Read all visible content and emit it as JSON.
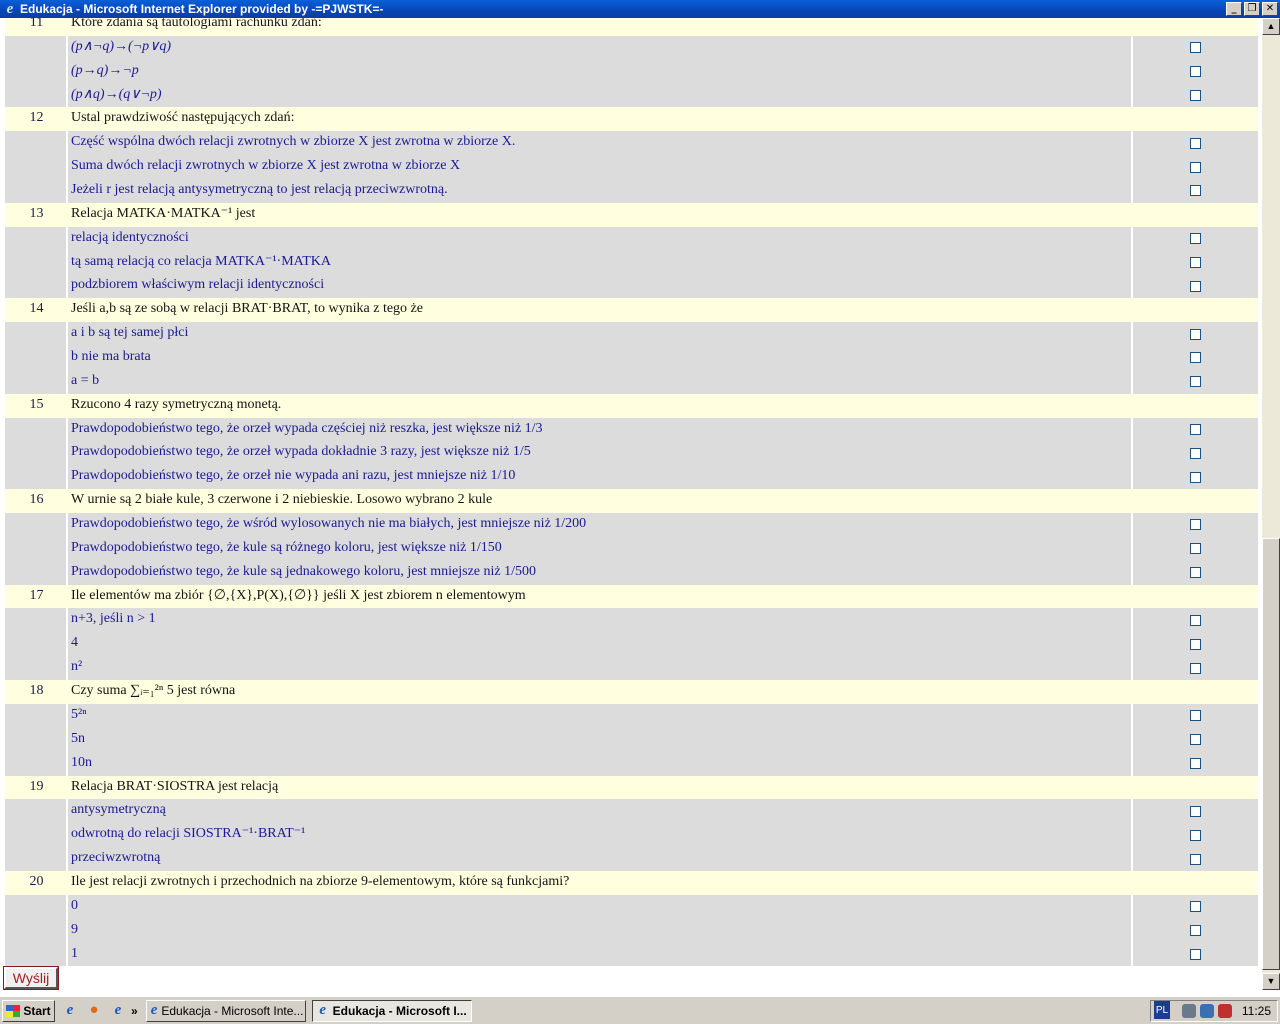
{
  "window": {
    "title": "Edukacja - Microsoft Internet Explorer provided by -=PJWSTK=-",
    "icon": "ie-icon",
    "buttons": [
      "_",
      "❐",
      "✕"
    ]
  },
  "quiz": [
    {
      "type": "q",
      "num": "11",
      "text": "Które zdania są tautologiami rachunku zdań:"
    },
    {
      "type": "a",
      "text": "(p∧¬q)→(¬p∨q)",
      "math": true
    },
    {
      "type": "a",
      "text": "(p→q)→¬p",
      "math": true
    },
    {
      "type": "a",
      "text": "(p∧q)→(q∨¬p)",
      "math": true
    },
    {
      "type": "q",
      "num": "12",
      "text": "Ustal prawdziwość następujących zdań:"
    },
    {
      "type": "a",
      "text": "Część wspólna dwóch relacji zwrotnych w zbiorze X jest zwrotna w zbiorze X."
    },
    {
      "type": "a",
      "text": "Suma dwóch relacji zwrotnych w zbiorze X jest zwrotna w zbiorze X"
    },
    {
      "type": "a",
      "text": "Jeżeli r jest relacją antysymetryczną to jest relacją przeciwzwrotną."
    },
    {
      "type": "q",
      "num": "13",
      "text": "Relacja MATKA·MATKA⁻¹ jest"
    },
    {
      "type": "a",
      "text": "relacją identyczności"
    },
    {
      "type": "a",
      "text": "tą samą relacją co relacja MATKA⁻¹·MATKA"
    },
    {
      "type": "a",
      "text": "podzbiorem właściwym relacji identyczności"
    },
    {
      "type": "q",
      "num": "14",
      "text": "Jeśli a,b są ze sobą w relacji BRAT·BRAT, to wynika z tego że"
    },
    {
      "type": "a",
      "text": "a i b są tej samej płci"
    },
    {
      "type": "a",
      "text": "b nie ma brata"
    },
    {
      "type": "a",
      "text": "a = b"
    },
    {
      "type": "q",
      "num": "15",
      "text": "Rzucono 4 razy symetryczną monetą."
    },
    {
      "type": "a",
      "text": "Prawdopodobieństwo tego, że orzeł wypada częściej niż reszka, jest większe niż 1/3"
    },
    {
      "type": "a",
      "text": "Prawdopodobieństwo tego, że orzeł wypada dokładnie 3 razy, jest większe niż 1/5"
    },
    {
      "type": "a",
      "text": "Prawdopodobieństwo tego, że orzeł nie wypada ani razu, jest mniejsze niż 1/10"
    },
    {
      "type": "q",
      "num": "16",
      "text": "W urnie są 2 białe kule, 3 czerwone i 2 niebieskie. Losowo wybrano 2 kule"
    },
    {
      "type": "a",
      "text": "Prawdopodobieństwo tego, że wśród wylosowanych nie ma białych, jest mniejsze niż 1/200"
    },
    {
      "type": "a",
      "text": "Prawdopodobieństwo tego, że kule są różnego koloru, jest większe niż 1/150"
    },
    {
      "type": "a",
      "text": "Prawdopodobieństwo tego, że kule są jednakowego koloru, jest mniejsze niż 1/500"
    },
    {
      "type": "q",
      "num": "17",
      "text": "Ile elementów ma zbiór {∅,{X},P(X),{∅}} jeśli X jest zbiorem n elementowym"
    },
    {
      "type": "a",
      "text": "n+3, jeśli n > 1"
    },
    {
      "type": "a",
      "text": "4"
    },
    {
      "type": "a",
      "text": "n²"
    },
    {
      "type": "q",
      "num": "18",
      "text": "Czy suma ∑ᵢ₌₁²ⁿ 5 jest równa"
    },
    {
      "type": "a",
      "text": "5²ⁿ"
    },
    {
      "type": "a",
      "text": "5n"
    },
    {
      "type": "a",
      "text": "10n"
    },
    {
      "type": "q",
      "num": "19",
      "text": "Relacja BRAT·SIOSTRA jest relacją"
    },
    {
      "type": "a",
      "text": "antysymetryczną"
    },
    {
      "type": "a",
      "text": "odwrotną do relacji SIOSTRA⁻¹·BRAT⁻¹"
    },
    {
      "type": "a",
      "text": "przeciwzwrotną"
    },
    {
      "type": "q",
      "num": "20",
      "text": "Ile jest relacji zwrotnych i przechodnich na zbiorze 9-elementowym, które są funkcjami?"
    },
    {
      "type": "a",
      "text": "0"
    },
    {
      "type": "a",
      "text": "9"
    },
    {
      "type": "a",
      "text": "1"
    }
  ],
  "submit": {
    "label": "Wyślij"
  },
  "taskbar": {
    "start": "Start",
    "overflow": "»",
    "tasks": [
      {
        "label": "Edukacja - Microsoft Inte...",
        "active": false
      },
      {
        "label": "Edukacja - Microsoft I...",
        "active": true
      }
    ],
    "lang": "PL",
    "clock": "11:25"
  }
}
